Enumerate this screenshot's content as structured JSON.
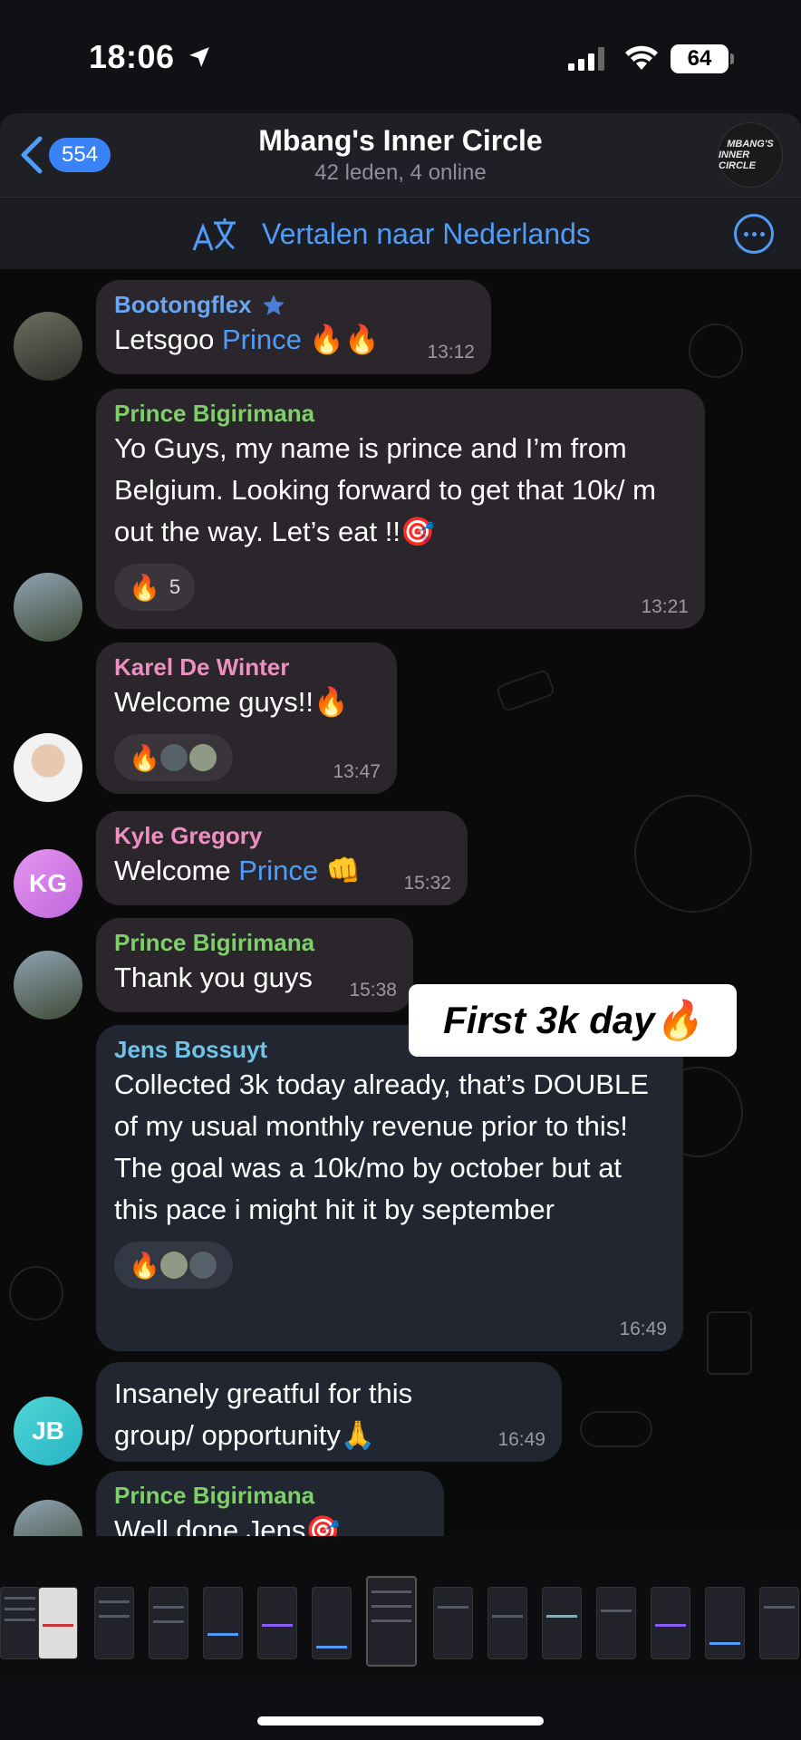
{
  "status_bar": {
    "time": "18:06",
    "battery": "64"
  },
  "header": {
    "back_count": "554",
    "title": "Mbang's Inner Circle",
    "subtitle": "42 leden, 4 online",
    "logo_text_1": "MBANG'S",
    "logo_text_2": "INNER CIRCLE"
  },
  "translate_bar": {
    "label": "Vertalen naar Nederlands"
  },
  "messages": [
    {
      "sender": "Bootongflex",
      "sender_color": "#6aa7f2",
      "text_before": "Letsgoo ",
      "mention": "Prince",
      "text_after": " 🔥🔥",
      "time": "13:12"
    },
    {
      "sender": "Prince Bigirimana",
      "sender_color": "#7fd06a",
      "text": "Yo Guys, my name is prince and I’m from Belgium. Looking forward to get that 10k/ m out the way. Let’s eat !!🎯",
      "reaction_emoji": "🔥",
      "reaction_count": "5",
      "time": "13:21"
    },
    {
      "sender": "Karel De Winter",
      "sender_color": "#ee8fc2",
      "text": "Welcome guys!!🔥",
      "reaction_emoji": "🔥",
      "time": "13:47"
    },
    {
      "sender": "Kyle Gregory",
      "sender_color": "#ee8fc2",
      "avatar_initials": "KG",
      "text_before": "Welcome ",
      "mention": "Prince",
      "text_after": " 👊",
      "time": "15:32"
    },
    {
      "sender": "Prince Bigirimana",
      "sender_color": "#7fd06a",
      "text": "Thank you guys",
      "time": "15:38"
    },
    {
      "sender": "Jens Bossuyt",
      "sender_color": "#6fc3e8",
      "text": "Collected 3k today already, that’s DOUBLE of my usual monthly revenue prior to this! The goal was a 10k/mo by october but at this pace i might hit it by september",
      "reaction_emoji": "🔥",
      "time": "16:49"
    },
    {
      "avatar_initials": "JB",
      "text": "Insanely greatful for this group/ opportunity🙏",
      "time": "16:49"
    },
    {
      "sender": "Prince Bigirimana",
      "sender_color": "#7fd06a",
      "text": "Well done Jens🎯"
    }
  ],
  "caption": "First 3k day🔥"
}
